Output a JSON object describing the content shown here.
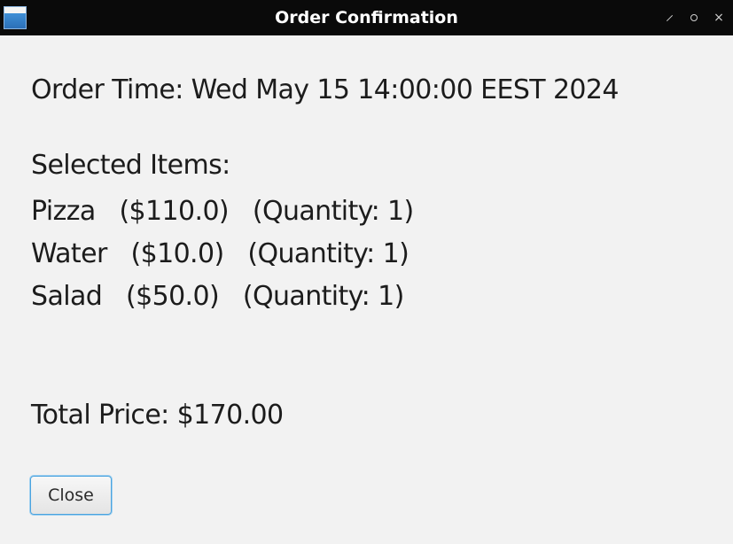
{
  "window": {
    "title": "Order Confirmation",
    "controls": [
      "restore-icon",
      "maximize-icon",
      "close-icon"
    ]
  },
  "order": {
    "time_line": "Order Time: Wed May 15 14:00:00 EEST 2024",
    "selected_header": "Selected Items:",
    "items": [
      {
        "text": "Pizza   ($110.0)   (Quantity: 1)"
      },
      {
        "text": "Water   ($10.0)   (Quantity: 1)"
      },
      {
        "text": "Salad   ($50.0)   (Quantity: 1)"
      }
    ],
    "total_line": "Total Price: $170.00"
  },
  "actions": {
    "close_label": "Close"
  },
  "colors": {
    "titlebar": "#0a0a0a",
    "background": "#f2f2f2",
    "button_focus": "#4aa3df"
  }
}
